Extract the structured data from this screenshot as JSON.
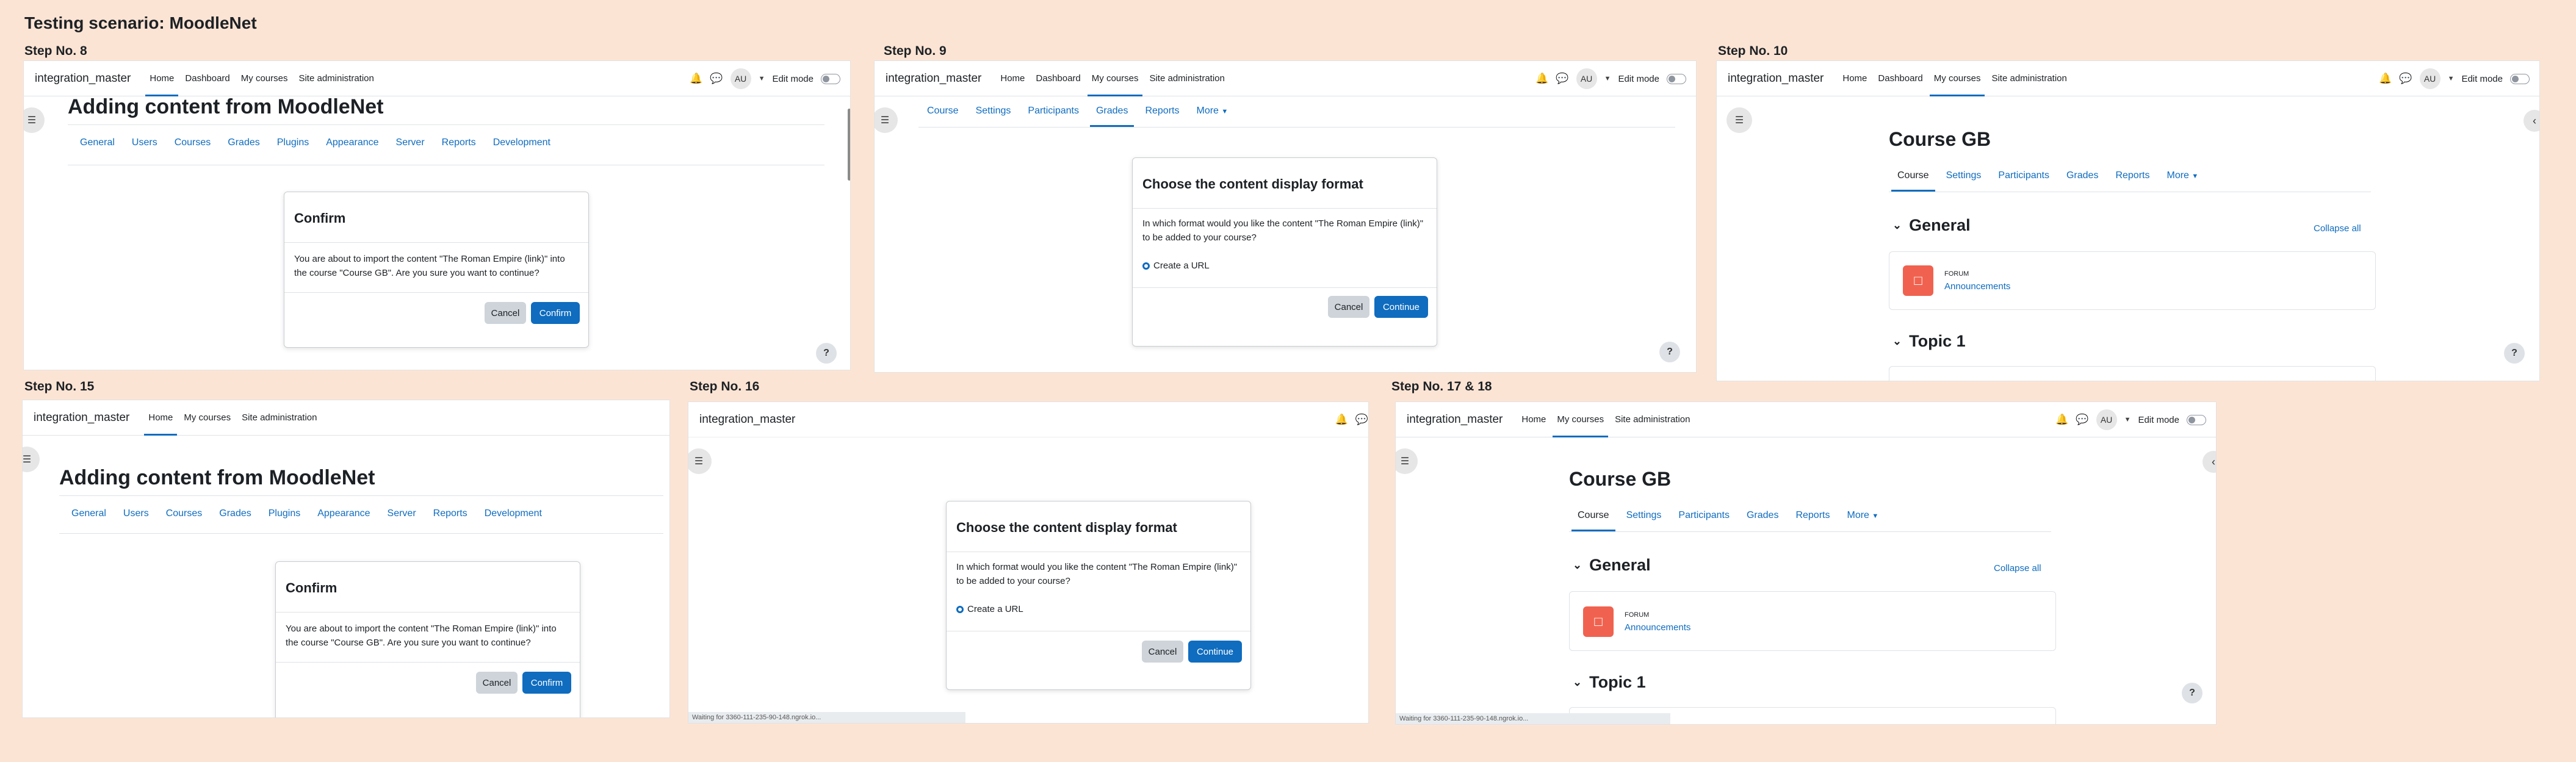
{
  "title": "Testing scenario: MoodleNet",
  "brand": "integration_master",
  "nav": {
    "home": "Home",
    "dashboard": "Dashboard",
    "my_courses": "My courses",
    "site_admin": "Site administration",
    "edit_mode": "Edit mode",
    "avatar": "AU"
  },
  "steps": {
    "s8": "Step No. 8",
    "s9": "Step No. 9",
    "s10": "Step No. 10",
    "s15": "Step No. 15",
    "s16": "Step No. 16",
    "s1718": "Step No. 17 & 18"
  },
  "admin": {
    "heading": "Adding content from MoodleNet",
    "tabs": [
      "General",
      "Users",
      "Courses",
      "Grades",
      "Plugins",
      "Appearance",
      "Server",
      "Reports",
      "Development"
    ]
  },
  "confirm_modal": {
    "title": "Confirm",
    "body": "You are about to import the content \"The Roman Empire (link)\" into the course \"Course GB\". Are you sure you want to continue?",
    "cancel": "Cancel",
    "confirm": "Confirm"
  },
  "format_modal": {
    "title": "Choose the content display format",
    "body": "In which format would you like the content \"The Roman Empire (link)\" to be added to your course?",
    "option": "Create a URL",
    "cancel": "Cancel",
    "continue": "Continue"
  },
  "course_tabs": [
    "Course",
    "Settings",
    "Participants",
    "Grades",
    "Reports",
    "More"
  ],
  "course": {
    "title": "Course GB",
    "general": "General",
    "collapse_all": "Collapse all",
    "forum_kind": "FORUM",
    "forum_name": "Announcements",
    "topic1": "Topic 1"
  },
  "help": "?",
  "status_text": "Waiting for 3360-111-235-90-148.ngrok.io..."
}
